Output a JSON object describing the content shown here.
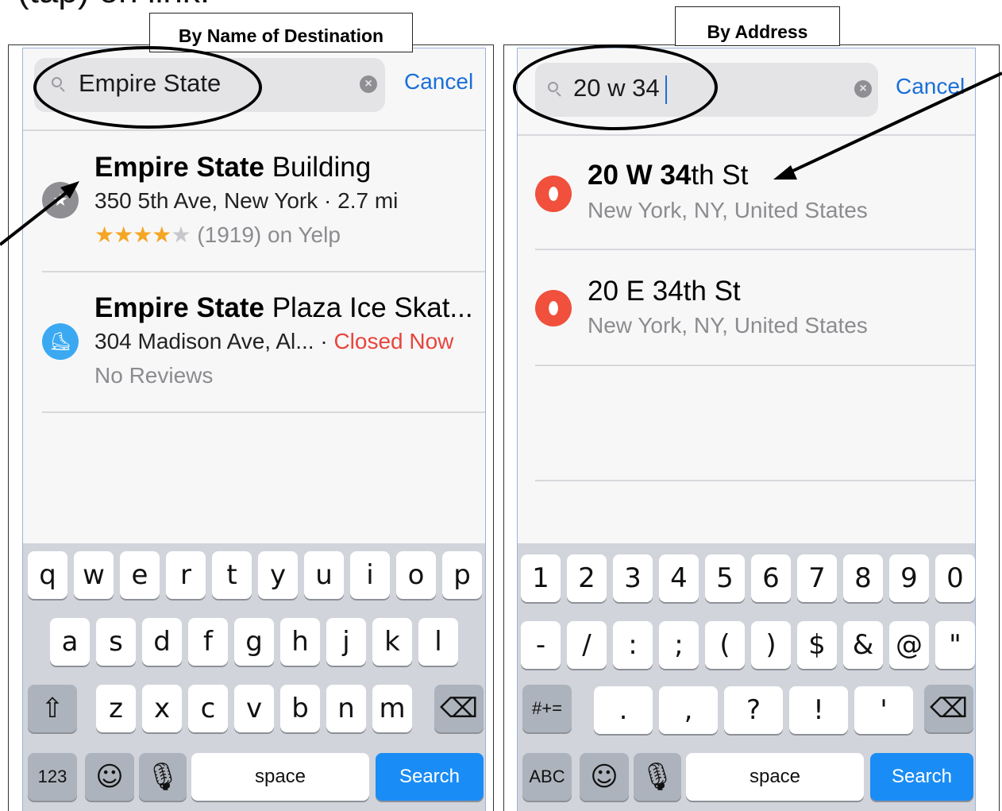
{
  "heading": "(tap) on link.",
  "left": {
    "caption": "By Name of Destination",
    "search_value": "Empire State",
    "cancel_label": "Cancel",
    "results": [
      {
        "title_bold": "Empire State",
        "title_rest": " Building",
        "address": "350 5th Ave, New York · 2.7 mi",
        "rating_stars": "★★★★",
        "rating_empty": "★",
        "rating_count": "(1919) on Yelp",
        "icon": "star-icon",
        "icon_color": "#8e8e93"
      },
      {
        "title_bold": "Empire State",
        "title_rest": " Plaza Ice Skat...",
        "address": "304 Madison Ave, Al... · ",
        "status": "Closed Now",
        "reviews": "No Reviews",
        "icon": "ice-skate-icon",
        "icon_color": "#3aa9f2"
      }
    ],
    "keyboard": {
      "row1": [
        "q",
        "w",
        "e",
        "r",
        "t",
        "y",
        "u",
        "i",
        "o",
        "p"
      ],
      "row2": [
        "a",
        "s",
        "d",
        "f",
        "g",
        "h",
        "j",
        "k",
        "l"
      ],
      "row3": [
        "z",
        "x",
        "c",
        "v",
        "b",
        "n",
        "m"
      ],
      "mode_key": "123",
      "space": "space",
      "action": "Search"
    }
  },
  "right": {
    "caption": "By Address",
    "search_value": "20 w 34",
    "cancel_label": "Cancel",
    "results": [
      {
        "title_bold": "20 W 34",
        "title_rest": "th St",
        "subtitle": "New York, NY, United States",
        "icon": "map-pin-icon",
        "icon_color": "#f0503c"
      },
      {
        "title_bold": "",
        "title_rest": "20 E 34th St",
        "subtitle": "New York, NY, United States",
        "icon": "map-pin-icon",
        "icon_color": "#f0503c"
      }
    ],
    "keyboard": {
      "row1": [
        "1",
        "2",
        "3",
        "4",
        "5",
        "6",
        "7",
        "8",
        "9",
        "0"
      ],
      "row2": [
        "-",
        "/",
        ":",
        ";",
        "(",
        ")",
        "$",
        "&",
        "@",
        "\""
      ],
      "row3": [
        ".",
        ",",
        "?",
        "!",
        "'"
      ],
      "symbol_key": "#+=",
      "mode_key": "ABC",
      "space": "space",
      "action": "Search"
    }
  }
}
